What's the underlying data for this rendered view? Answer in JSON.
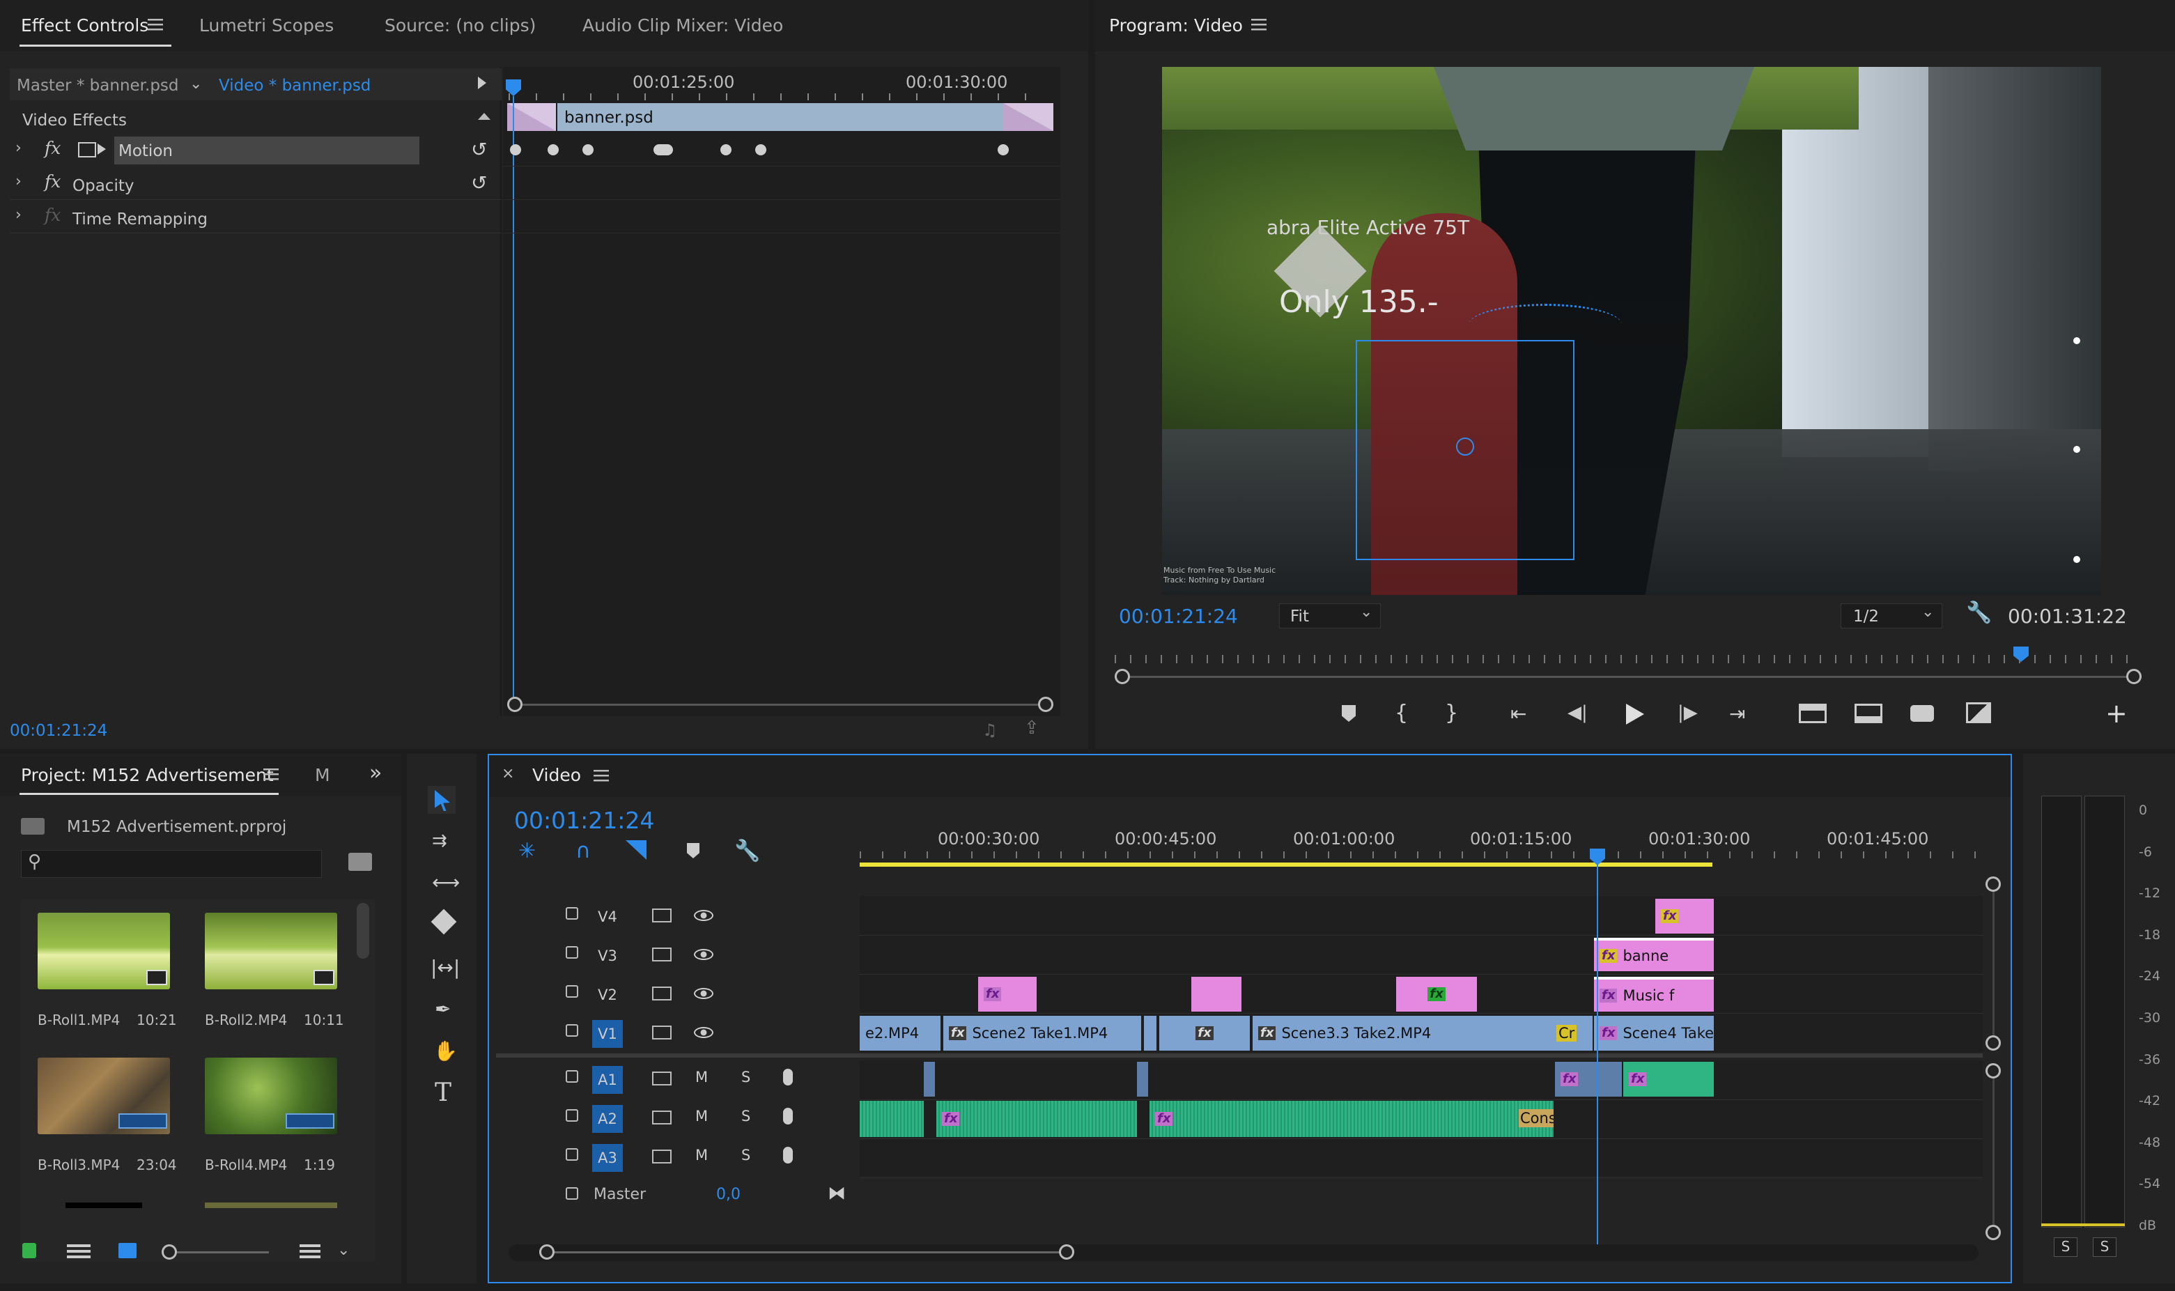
{
  "effect_controls": {
    "tabs": [
      "Effect Controls",
      "Lumetri Scopes",
      "Source: (no clips)",
      "Audio Clip Mixer: Video"
    ],
    "master_label": "Master * banner.psd",
    "clip_label": "Video * banner.psd",
    "section": "Video Effects",
    "effects": [
      "Motion",
      "Opacity",
      "Time Remapping"
    ],
    "ruler": [
      "00:01:25:00",
      "00:01:30:00"
    ],
    "clip_name": "banner.psd",
    "timecode": "00:01:21:24"
  },
  "program": {
    "title": "Program: Video",
    "timecode": "00:01:21:24",
    "fit": "Fit",
    "resolution": "1/2",
    "duration": "00:01:31:22",
    "overlay_line1": "abra Elite Active 75T",
    "overlay_line2": "Only 135.-",
    "credit_line1": "Music from Free To Use Music",
    "credit_line2": "Track: Nothing by Dartlard",
    "playhead_fraction": 0.885
  },
  "project": {
    "title": "Project: M152 Advertisement",
    "tab2": "M",
    "file": "M152 Advertisement.prproj",
    "search_placeholder": "",
    "items": [
      {
        "name": "B-Roll1.MP4",
        "duration": "10:21"
      },
      {
        "name": "B-Roll2.MP4",
        "duration": "10:11"
      },
      {
        "name": "B-Roll3.MP4",
        "duration": "23:04"
      },
      {
        "name": "B-Roll4.MP4",
        "duration": "1:19"
      }
    ]
  },
  "timeline": {
    "title": "Video",
    "timecode": "00:01:21:24",
    "ruler": [
      "00:00:30:00",
      "00:00:45:00",
      "00:01:00:00",
      "00:01:15:00",
      "00:01:30:00",
      "00:01:45:00"
    ],
    "video_tracks": [
      "V4",
      "V3",
      "V2",
      "V1"
    ],
    "audio_tracks": [
      "A1",
      "A2",
      "A3"
    ],
    "master_label": "Master",
    "master_value": "0,0",
    "mute": "M",
    "solo": "S",
    "clips": {
      "v1_a": "e2.MP4",
      "v1_b": "Scene2 Take1.MP4",
      "v1_c": "Scene3.3 Take2.MP4",
      "v1_d": "Scene4 Take",
      "v1_cr": "Cr",
      "v3_a": "banne",
      "v2_d": "Music f",
      "a2_tail": "Cons",
      "fx": "fx"
    }
  },
  "meter": {
    "ticks": [
      "0",
      "-6",
      "-12",
      "-18",
      "-24",
      "-30",
      "-36",
      "-42",
      "-48",
      "-54",
      "dB"
    ],
    "solo": [
      "S",
      "S"
    ]
  },
  "colors": {
    "accent": "#2d8ceb",
    "video_clip": "#7fa3d1",
    "graphic_clip": "#e589e0",
    "audio_clip": "#2fb583",
    "work_area": "#ebe23a"
  }
}
